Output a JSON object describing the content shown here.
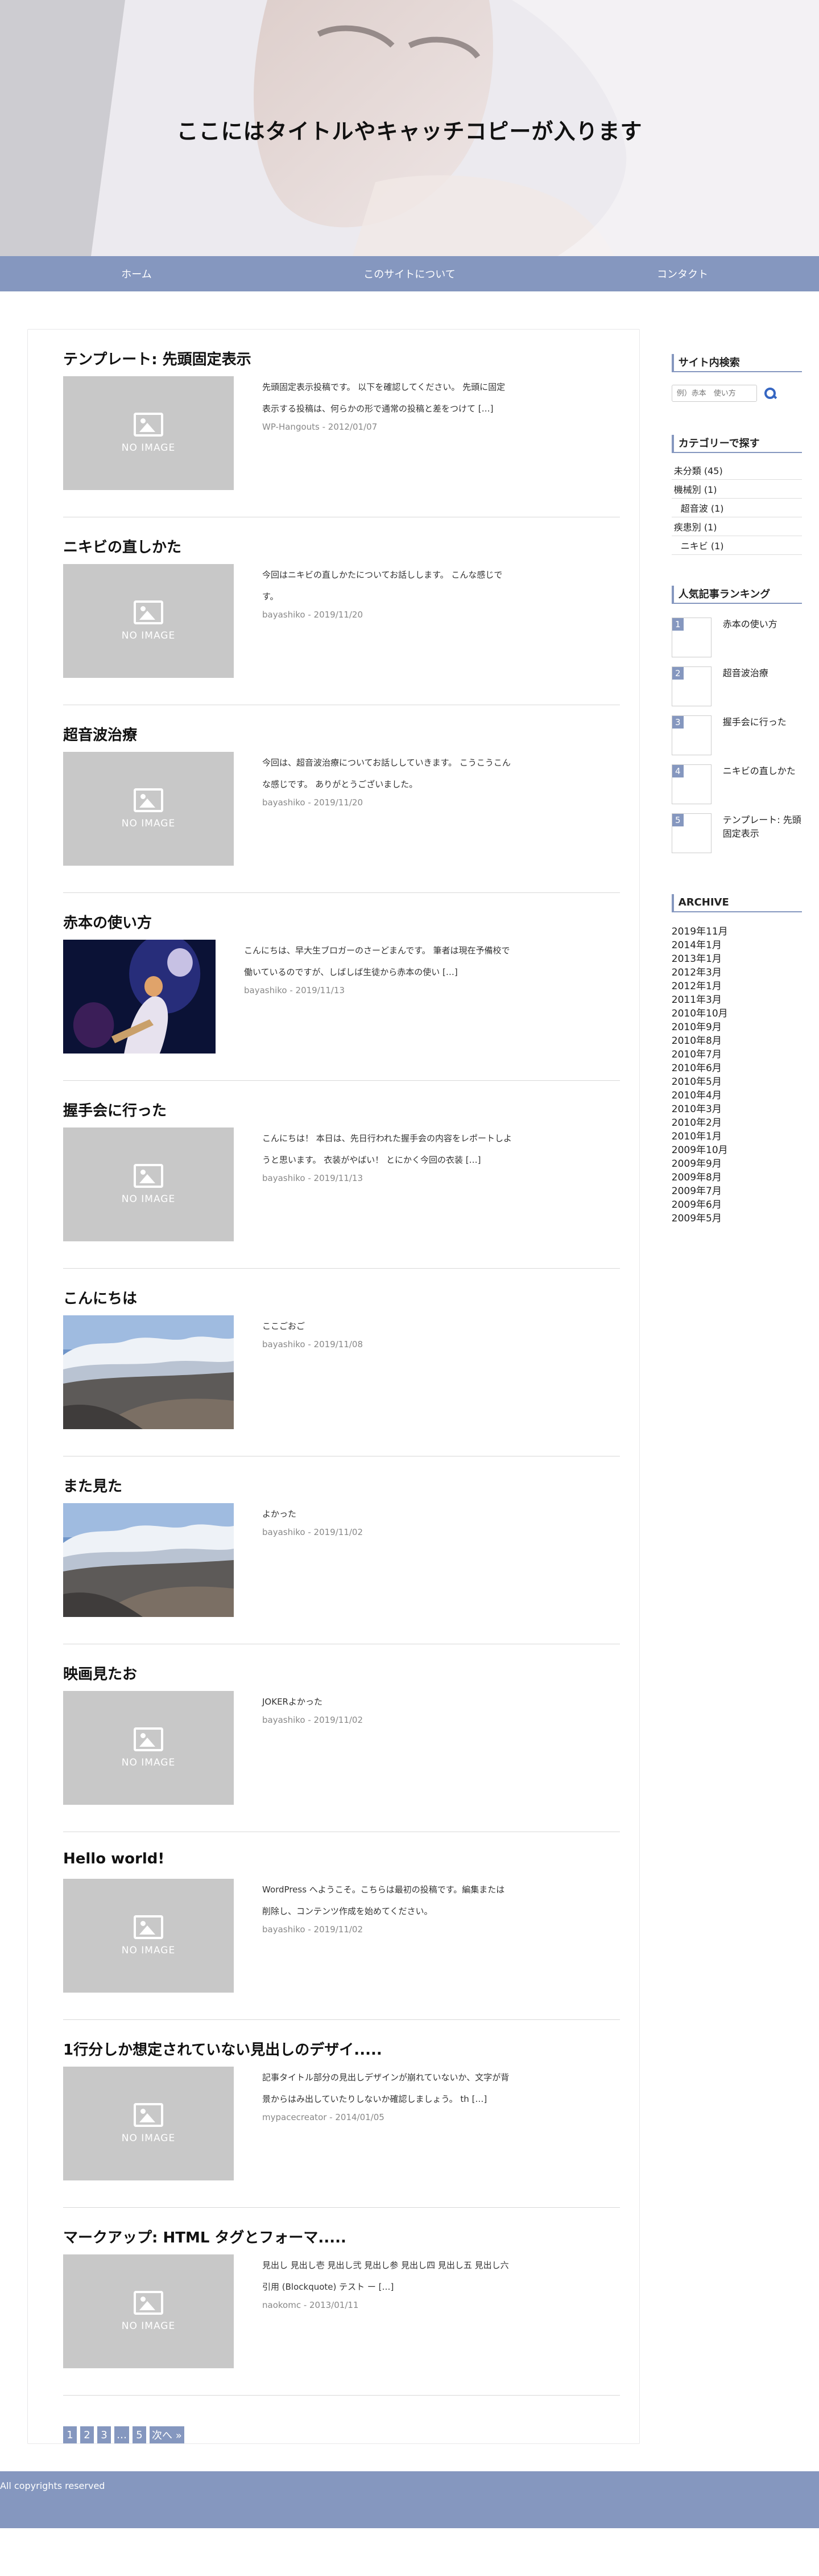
{
  "header": {
    "title": "ここにはタイトルやキャッチコピーが入ります"
  },
  "nav": {
    "items": [
      "ホーム",
      "このサイトについて",
      "コンタクト"
    ]
  },
  "no_image_label": "NO IMAGE",
  "posts": [
    {
      "title": "テンプレート: 先頭固定表示",
      "excerpt": "先頭固定表示投稿です。 以下を確認してください。 先頭に固定表示する投稿は、何らかの形で通常の投稿と差をつけて […]",
      "meta": "WP-Hangouts - 2012/01/07",
      "thumb": "noimage"
    },
    {
      "title": "ニキビの直しかた",
      "excerpt": "今回はニキビの直しかたについてお話しします。 こんな感じです。",
      "meta": "bayashiko - 2019/11/20",
      "thumb": "noimage"
    },
    {
      "title": "超音波治療",
      "excerpt": "今回は、超音波治療についてお話ししていきます。 こうこうこんな感じです。 ありがとうございました。",
      "meta": "bayashiko - 2019/11/20",
      "thumb": "noimage"
    },
    {
      "title": "赤本の使い方",
      "excerpt": "こんにちは、早大生ブロガーのさーどまんです。 筆者は現在予備校で働いているのですが、しばしば生徒から赤本の使い […]",
      "meta": "bayashiko - 2019/11/13",
      "thumb": "concert"
    },
    {
      "title": "握手会に行った",
      "excerpt": "こんにちは！ 本日は、先日行われた握手会の内容をレポートしようと思います。 衣装がやばい！ とにかく今回の衣装 […]",
      "meta": "bayashiko - 2019/11/13",
      "thumb": "noimage"
    },
    {
      "title": "こんにちは",
      "excerpt": "ここごおご",
      "meta": "bayashiko - 2019/11/08",
      "thumb": "mountain"
    },
    {
      "title": "また見た",
      "excerpt": "よかった",
      "meta": "bayashiko - 2019/11/02",
      "thumb": "mountain"
    },
    {
      "title": "映画見たお",
      "excerpt": "JOKERよかった",
      "meta": "bayashiko - 2019/11/02",
      "thumb": "noimage"
    },
    {
      "title": "Hello world!",
      "excerpt": "WordPress へようこそ。こちらは最初の投稿です。編集または削除し、コンテンツ作成を始めてください。",
      "meta": "bayashiko - 2019/11/02",
      "thumb": "noimage"
    },
    {
      "title": "1行分しか想定されていない見出しのデザイ.....",
      "excerpt": "記事タイトル部分の見出しデザインが崩れていないか、文字が背景からはみ出していたりしないか確認しましょう。 th […]",
      "meta": "mypacecreator - 2014/01/05",
      "thumb": "noimage"
    },
    {
      "title": "マークアップ: HTML タグとフォーマ.....",
      "excerpt": "見出し 見出し壱 見出し弐 見出し参 見出し四 見出し五 見出し六 引用 (Blockquote) テスト ー […]",
      "meta": "naokomc - 2013/01/11",
      "thumb": "noimage"
    }
  ],
  "pagination": [
    "1",
    "2",
    "3",
    "…",
    "5",
    "次へ »"
  ],
  "sidebar": {
    "search": {
      "title": "サイト内検索",
      "placeholder": "例）赤本　使い方"
    },
    "categories": {
      "title": "カテゴリーで探す",
      "items": [
        {
          "label": "未分類 (45)",
          "child": false
        },
        {
          "label": "機械別 (1)",
          "child": false
        },
        {
          "label": "超音波 (1)",
          "child": true
        },
        {
          "label": "疾患別 (1)",
          "child": false
        },
        {
          "label": "ニキビ (1)",
          "child": true
        }
      ]
    },
    "ranking": {
      "title": "人気記事ランキング",
      "items": [
        {
          "num": "1",
          "title": "赤本の使い方"
        },
        {
          "num": "2",
          "title": "超音波治療"
        },
        {
          "num": "3",
          "title": "握手会に行った"
        },
        {
          "num": "4",
          "title": "ニキビの直しかた"
        },
        {
          "num": "5",
          "title": "テンプレート: 先頭固定表示"
        }
      ]
    },
    "archive": {
      "title": "ARCHIVE",
      "items": [
        "2019年11月",
        "2014年1月",
        "2013年1月",
        "2012年3月",
        "2012年1月",
        "2011年3月",
        "2010年10月",
        "2010年9月",
        "2010年8月",
        "2010年7月",
        "2010年6月",
        "2010年5月",
        "2010年4月",
        "2010年3月",
        "2010年2月",
        "2010年1月",
        "2009年10月",
        "2009年9月",
        "2009年8月",
        "2009年7月",
        "2009年6月",
        "2009年5月"
      ]
    }
  },
  "footer": {
    "copyright": "All copyrights reserved"
  },
  "colors": {
    "accent": "#8597bf",
    "search_icon": "#3566c2",
    "noimage_bg": "#c8c8c8"
  }
}
